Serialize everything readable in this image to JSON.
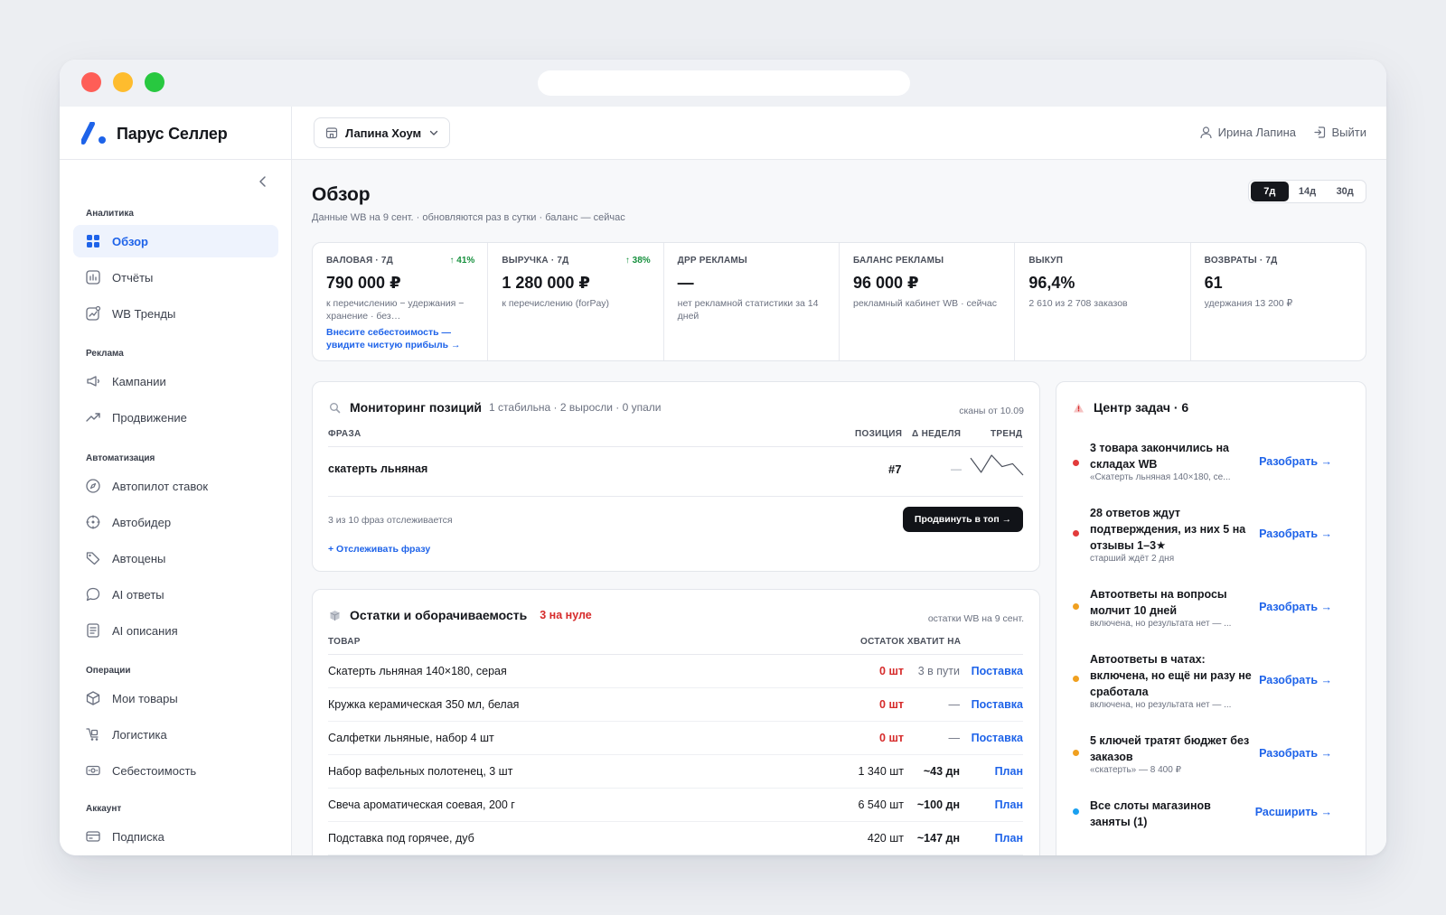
{
  "app": {
    "name": "Парус Селлер",
    "store": "Лапина Хоум",
    "user": "Ирина Лапина",
    "logout": "Выйти"
  },
  "colors": {
    "accent": "#1e63e9",
    "positive": "#18913f",
    "danger": "#d62b2b",
    "warning": "#f0a020",
    "info": "#1aa0f0"
  },
  "sidebar": {
    "sections": [
      {
        "label": "Аналитика",
        "items": [
          {
            "label": "Обзор",
            "icon": "grid-icon",
            "active": true
          },
          {
            "label": "Отчёты",
            "icon": "chart-icon"
          },
          {
            "label": "WB Тренды",
            "icon": "trend-card-icon"
          }
        ]
      },
      {
        "label": "Реклама",
        "items": [
          {
            "label": "Кампании",
            "icon": "megaphone-icon"
          },
          {
            "label": "Продвижение",
            "icon": "trending-up-icon"
          }
        ]
      },
      {
        "label": "Автоматизация",
        "items": [
          {
            "label": "Автопилот ставок",
            "icon": "compass-icon"
          },
          {
            "label": "Автобидер",
            "icon": "target-icon"
          },
          {
            "label": "Автоцены",
            "icon": "tag-icon"
          },
          {
            "label": "AI ответы",
            "icon": "chat-icon"
          },
          {
            "label": "AI описания",
            "icon": "document-icon"
          }
        ]
      },
      {
        "label": "Операции",
        "items": [
          {
            "label": "Мои товары",
            "icon": "box-icon"
          },
          {
            "label": "Логистика",
            "icon": "cart-icon"
          },
          {
            "label": "Себестоимость",
            "icon": "cash-icon"
          }
        ]
      },
      {
        "label": "Аккаунт",
        "items": [
          {
            "label": "Подписка",
            "icon": "card-icon"
          }
        ]
      }
    ]
  },
  "overview": {
    "title": "Обзор",
    "subtitle": "Данные WB на 9 сент. · обновляются раз в сутки · баланс — сейчас",
    "periods": [
      "7д",
      "14д",
      "30д"
    ],
    "active_period": "7д"
  },
  "kpis": [
    {
      "label": "ВАЛОВАЯ · 7Д",
      "delta": "↑ 41%",
      "value": "790 000 ₽",
      "note": "к перечислению − удержания − хранение · без…",
      "link": "Внесите себестоимость — увидите чистую прибыль →"
    },
    {
      "label": "ВЫРУЧКА · 7Д",
      "delta": "↑ 38%",
      "value": "1 280 000 ₽",
      "note": "к перечислению (forPay)",
      "link": ""
    },
    {
      "label": "ДРР РЕКЛАМЫ",
      "delta": "",
      "value": "—",
      "note": "нет рекламной статистики за 14 дней",
      "link": ""
    },
    {
      "label": "БАЛАНС РЕКЛАМЫ",
      "delta": "",
      "value": "96 000 ₽",
      "note": "рекламный кабинет WB · сейчас",
      "link": ""
    },
    {
      "label": "ВЫКУП",
      "delta": "",
      "value": "96,4%",
      "note": "2 610 из 2 708 заказов",
      "link": ""
    },
    {
      "label": "ВОЗВРАТЫ · 7Д",
      "delta": "",
      "value": "61",
      "note": "удержания 13 200 ₽",
      "link": ""
    }
  ],
  "positions": {
    "title": "Мониторинг позиций",
    "meta": "1 стабильна · 2 выросли · 0 упали",
    "aside": "сканы от 10.09",
    "columns": {
      "phrase": "ФРАЗА",
      "position": "ПОЗИЦИЯ",
      "week": "Δ НЕДЕЛЯ",
      "trend": "ТРЕНД"
    },
    "rows": [
      {
        "phrase": "скатерть льняная",
        "position": "#7",
        "week": "—",
        "trend": [
          3,
          8,
          2,
          6,
          5,
          9
        ]
      }
    ],
    "tracked": "3 из 10 фраз отслеживается",
    "promote": "Продвинуть в топ →",
    "add": "+ Отслеживать фразу"
  },
  "stock": {
    "title": "Остатки и оборачиваемость",
    "alert": "3 на нуле",
    "aside": "остатки WB на 9 сент.",
    "columns": {
      "product": "ТОВАР",
      "remain": "ОСТАТОК ХВАТИТ НА"
    },
    "rows": [
      {
        "name": "Скатерть льняная 140×180, серая",
        "qty": "0 шт",
        "zero": true,
        "days": "3 в пути",
        "action": "Поставка"
      },
      {
        "name": "Кружка керамическая 350 мл, белая",
        "qty": "0 шт",
        "zero": true,
        "days": "—",
        "action": "Поставка"
      },
      {
        "name": "Салфетки льняные, набор 4 шт",
        "qty": "0 шт",
        "zero": true,
        "days": "—",
        "action": "Поставка"
      },
      {
        "name": "Набор вафельных полотенец, 3 шт",
        "qty": "1 340 шт",
        "zero": false,
        "days": "~43 дн",
        "action": "План"
      },
      {
        "name": "Свеча ароматическая соевая, 200 г",
        "qty": "6 540 шт",
        "zero": false,
        "days": "~100 дн",
        "action": "План"
      },
      {
        "name": "Подставка под горячее, дуб",
        "qty": "420 шт",
        "zero": false,
        "days": "~147 дн",
        "action": "План"
      }
    ]
  },
  "tasks": {
    "title": "Центр задач · 6",
    "items": [
      {
        "title": "3 товара закончились на складах WB",
        "sub": "«Скатерть льняная 140×180, се...",
        "action": "Разобрать →",
        "color": "red"
      },
      {
        "title": "28 ответов ждут подтверждения, из них 5 на отзывы 1–3★",
        "sub": "старший ждёт 2 дня",
        "action": "Разобрать →",
        "color": "red"
      },
      {
        "title": "Автоответы на вопросы молчит 10 дней",
        "sub": "включена, но результата нет — ...",
        "action": "Разобрать →",
        "color": "orange"
      },
      {
        "title": "Автоответы в чатах: включена, но ещё ни разу не сработала",
        "sub": "включена, но результата нет — ...",
        "action": "Разобрать →",
        "color": "orange"
      },
      {
        "title": "5 ключей тратят бюджет без заказов",
        "sub": "«скатерть» — 8 400 ₽",
        "action": "Разобрать →",
        "color": "orange"
      },
      {
        "title": "Все слоты магазинов заняты (1)",
        "sub": "",
        "action": "Расширить →",
        "color": "blue"
      }
    ]
  }
}
